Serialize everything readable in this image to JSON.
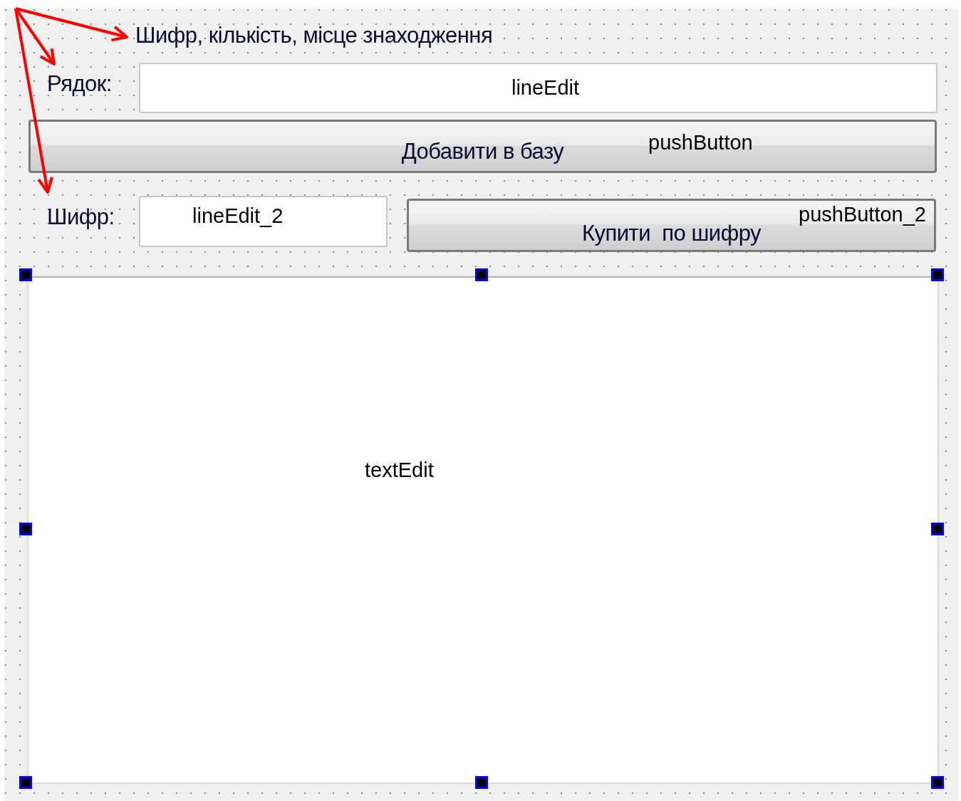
{
  "heading": "Шифр, кількість, місце знаходження",
  "line_row": {
    "label": "Рядок:",
    "field_object_name": "lineEdit"
  },
  "add_button": {
    "label": "Добавити в базу",
    "object_name": "pushButton"
  },
  "code_row": {
    "label": "Шифр:",
    "field_object_name": "lineEdit_2",
    "button": {
      "label": "Купити  по шифру",
      "object_name": "pushButton_2"
    }
  },
  "text_edit": {
    "object_name": "textEdit",
    "selected": true
  }
}
